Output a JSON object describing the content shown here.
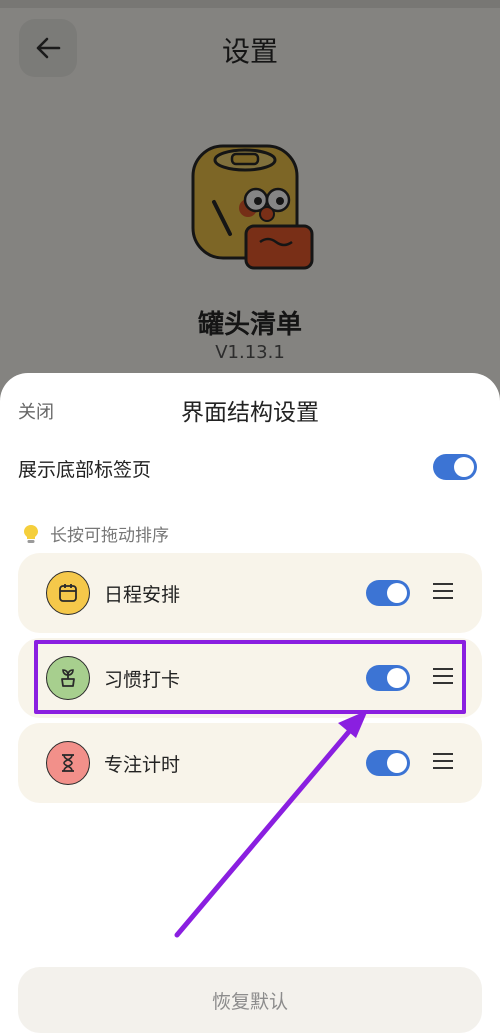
{
  "page": {
    "title": "设置",
    "app_name": "罐头清单",
    "version": "V1.13.1"
  },
  "sheet": {
    "close_label": "关闭",
    "title": "界面结构设置",
    "show_tabs_label": "展示底部标签页",
    "show_tabs_on": true,
    "hint": "长按可拖动排序",
    "items": [
      {
        "label": "日程安排",
        "icon": "calendar-icon",
        "color": "#f5c84a",
        "enabled": true
      },
      {
        "label": "习惯打卡",
        "icon": "sprout-icon",
        "color": "#a7cf8e",
        "enabled": true
      },
      {
        "label": "专注计时",
        "icon": "hourglass-icon",
        "color": "#f2908a",
        "enabled": true
      }
    ],
    "restore_label": "恢复默认"
  },
  "colors": {
    "toggle_on": "#3c74d4",
    "highlight": "#8a1fe0",
    "card_bg": "#f8f4ea"
  }
}
